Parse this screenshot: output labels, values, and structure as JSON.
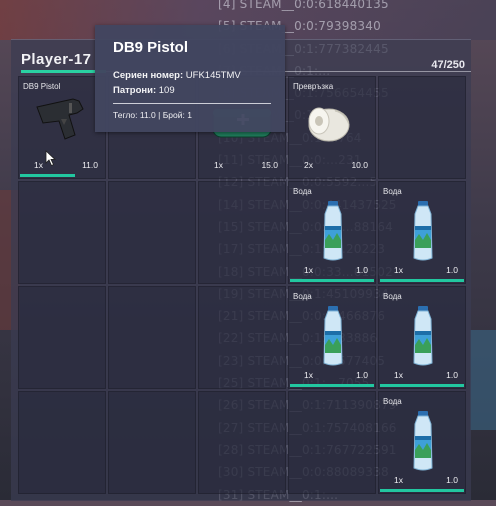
{
  "console": {
    "lines": [
      "[4] STEAM__0:0:618440135",
      "[5] STEAM__0:0:79398340",
      "[6] STEAM__0:1:777382445",
      "[7] STEAM__0:1:...",
      "[8] STEAM__0:1:756654455",
      "[9] STEAM__0:1:...",
      "[10] STEAM__0:1:...764",
      "[11] STEAM__0:0:...231",
      "[12] STEAM__0:0:5592...5",
      "[14] STEAM__0:0:441437525",
      "[15] STEAM__0:0:99...88164",
      "[17] STEAM__0:1:5...20223",
      "[18] STEAM__0:0:33...61502",
      "[19] STEAM__0:1:45109934",
      "[21] STEAM__0:0:...466876",
      "[22] STEAM__0:1:...33886",
      "[23] STEAM__0:0:...577405",
      "[25] STEAM__0:1:...7055",
      "[26] STEAM__0:1:711390879",
      "[27] STEAM__0:1:757408166",
      "[28] STEAM__0:1:767722591",
      "[30] STEAM__0:0:88089338",
      "[31] STEAM__0:1:..."
    ]
  },
  "inventory": {
    "player": "Player-17",
    "capacity": "47/250",
    "accent": "#22c7a0",
    "cells": [
      {
        "row": 0,
        "col": 0,
        "label": "DB9 Pistol",
        "qty": "1x",
        "weight": "11.0",
        "icon": "pistol-icon",
        "bar": true
      },
      {
        "row": 0,
        "col": 2,
        "label": "",
        "qty": "1x",
        "weight": "15.0",
        "icon": "medkit-bag-icon",
        "bar": false
      },
      {
        "row": 0,
        "col": 3,
        "label": "Превръзка",
        "qty": "2x",
        "weight": "10.0",
        "icon": "bandage-roll-icon",
        "bar": false
      },
      {
        "row": 1,
        "col": 3,
        "label": "Вода",
        "qty": "1x",
        "weight": "1.0",
        "icon": "water-bottle-icon",
        "bar": true
      },
      {
        "row": 1,
        "col": 4,
        "label": "Вода",
        "qty": "1x",
        "weight": "1.0",
        "icon": "water-bottle-icon",
        "bar": true
      },
      {
        "row": 2,
        "col": 3,
        "label": "Вода",
        "qty": "1x",
        "weight": "1.0",
        "icon": "water-bottle-icon",
        "bar": true
      },
      {
        "row": 2,
        "col": 4,
        "label": "Вода",
        "qty": "1x",
        "weight": "1.0",
        "icon": "water-bottle-icon",
        "bar": true
      },
      {
        "row": 3,
        "col": 4,
        "label": "Вода",
        "qty": "1x",
        "weight": "1.0",
        "icon": "water-bottle-icon",
        "bar": true
      }
    ]
  },
  "tooltip": {
    "title": "DB9 Pistol",
    "serial_label": "Сериен номер:",
    "serial_value": "UFK145TMV",
    "ammo_label": "Патрони:",
    "ammo_value": "109",
    "footer": "Тегло: 11.0 | Брой: 1"
  }
}
